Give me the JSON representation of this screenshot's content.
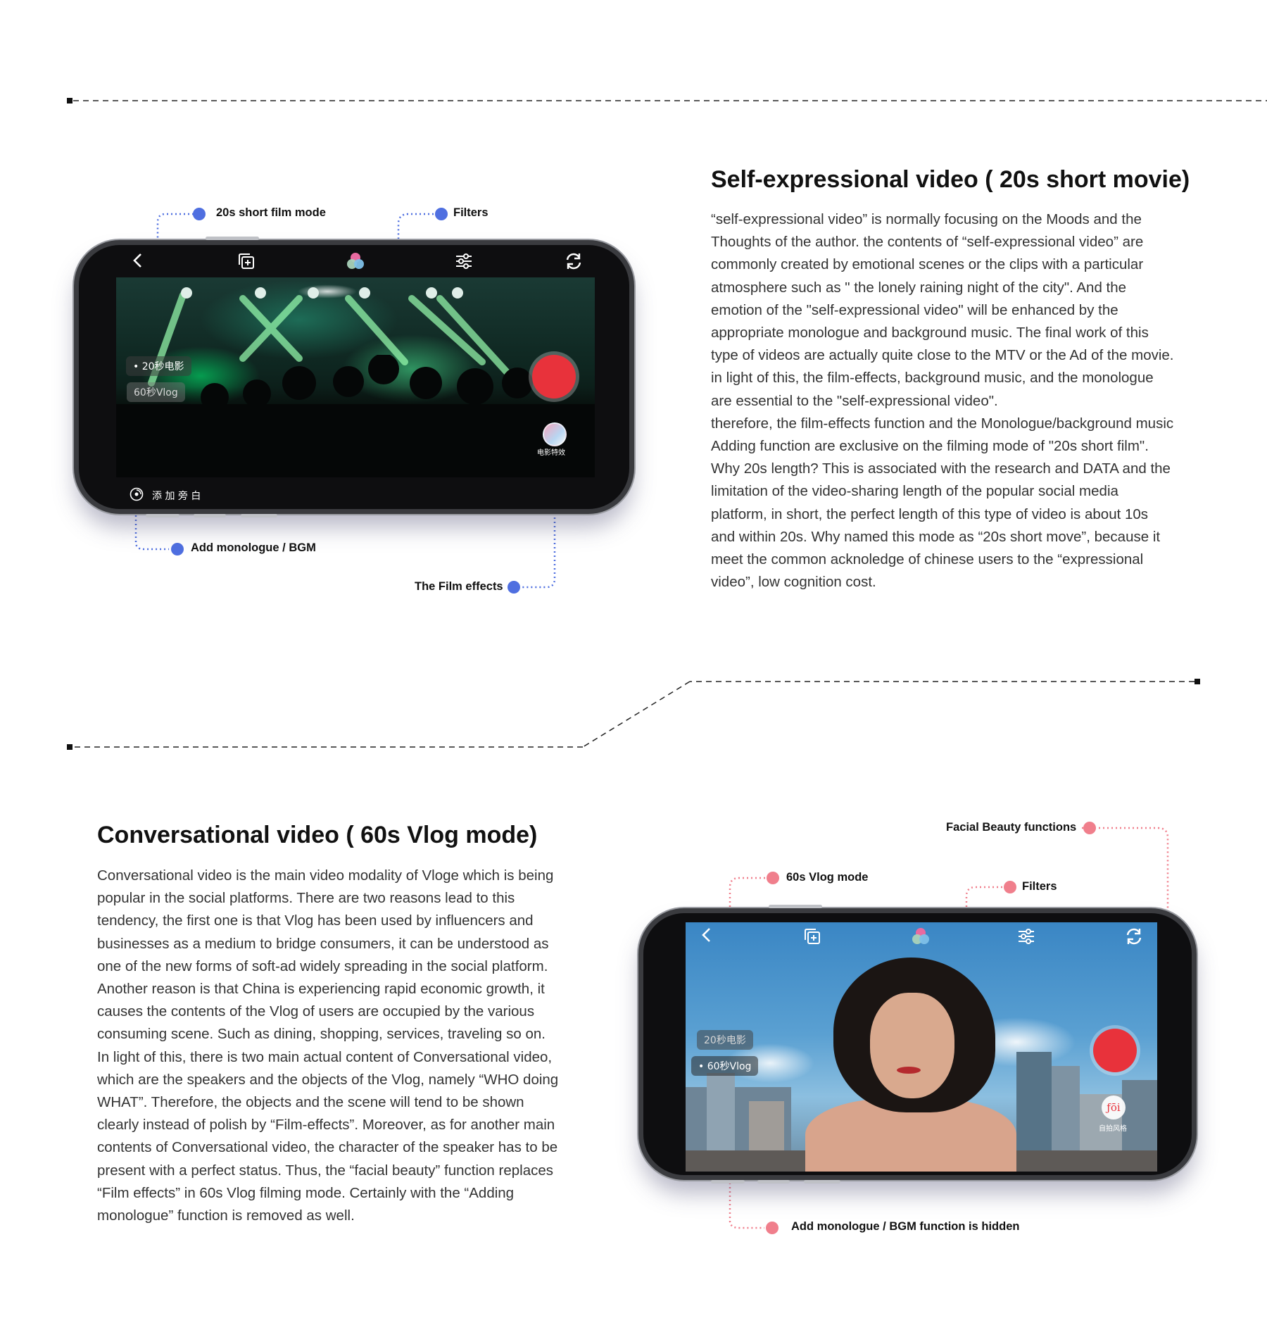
{
  "section1": {
    "title": "Self-expressional video ( 20s short movie)",
    "paragraph": "“self-expressional video” is normally focusing on the Moods and the Thoughts of the author. the contents of “self-expressional video” are commonly created by emotional scenes or the clips with a particular atmosphere such as \" the lonely raining night of the city\". And the emotion of the \"self-expressional video\" will be enhanced by the appropriate monologue and background music. The final work of this type of videos are actually quite close to the MTV or the Ad of the movie. in light of this, the film-effects, background music, and the monologue are essential to the \"self-expressional video\".",
    "paragraph2": "therefore, the film-effects function and the Monologue/background music Adding function are exclusive on the filming mode of \"20s short film\". Why 20s length? This is associated with the research and DATA and the limitation of the video-sharing length of the popular social media platform, in short, the perfect length of this type of video is about 10s and within 20s. Why named this mode as “20s short move”, because it meet the common acknoledge of chinese users to the “expressional video”, low cognition cost.",
    "callouts": {
      "mode": "20s short film mode",
      "filters": "Filters",
      "monologue": "Add monologue / BGM",
      "film_effects": "The Film effects"
    },
    "phone": {
      "mode_active": "• 20秒电影",
      "mode_inactive": "60秒Vlog",
      "film_effect_label": "电影特效",
      "add_monologue": "添 加 旁 白"
    }
  },
  "section2": {
    "title": "Conversational video ( 60s Vlog mode)",
    "paragraph": "Conversational video is the main video modality of Vloge which is being popular in the social platforms. There are two reasons lead to this tendency, the first one is that Vlog has been used by influencers and businesses as a medium to bridge consumers, it can be understood as one of the new forms of soft-ad widely spreading in the social platform. Another reason is that China is experiencing rapid economic growth, it causes the contents of the Vlog of users are occupied by the various consuming scene. Such as dining, shopping, services, traveling so on.",
    "paragraph2": "In light of this, there is two main actual content of Conversational video, which are the speakers and the objects of the Vlog, namely “WHO doing WHAT”. Therefore, the objects and the scene will tend to be shown clearly instead of polish by “Film-effects”. Moreover, as for another main contents of Conversational video, the character of the speaker has to be present with a perfect status. Thus, the “facial beauty” function replaces “Film effects” in 60s Vlog filming mode. Certainly with the “Adding monologue” function is removed as well.",
    "callouts": {
      "facial": "Facial Beauty  functions",
      "mode": "60s Vlog mode",
      "filters": "Filters",
      "monologue_hidden": "Add monologue / BGM function is hidden"
    },
    "phone": {
      "mode_inactive": "20秒电影",
      "mode_active": "• 60秒Vlog",
      "beauty_label": "自拍风格",
      "beauty_icon_text": "ƒōi"
    }
  },
  "colors": {
    "blue_accent": "#4f6fe0",
    "pink_accent": "#f07f8c",
    "record_red": "#e8323b"
  }
}
